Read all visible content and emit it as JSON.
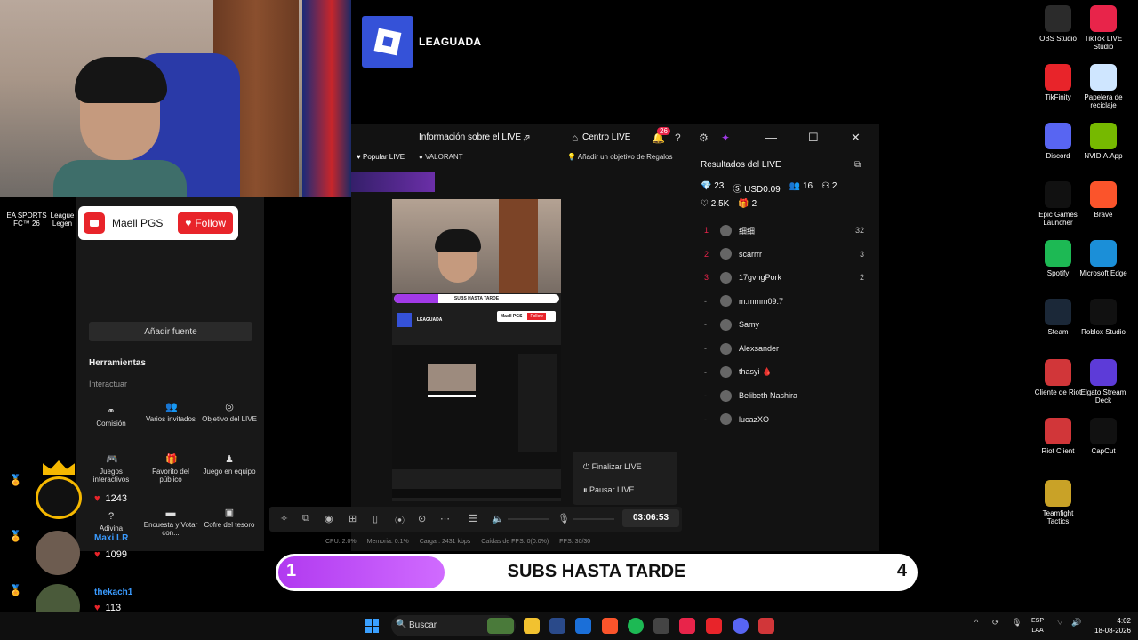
{
  "branding": {
    "overlay_logo_text": "LEAGUADA"
  },
  "follow_card": {
    "name": "Maell PGS",
    "button": "Follow"
  },
  "left_panel": {
    "add_source": "Añadir fuente",
    "tools_title": "Herramientas",
    "tools_sub": "Interactuar",
    "tools": [
      {
        "icon": "link-icon",
        "label": "Comisión"
      },
      {
        "icon": "guests-icon",
        "label": "Varios invitados"
      },
      {
        "icon": "target-icon",
        "label": "Objetivo del LIVE"
      },
      {
        "icon": "gamepad-icon",
        "label": "Juegos interactivos"
      },
      {
        "icon": "gift-icon",
        "label": "Favorito del público"
      },
      {
        "icon": "team-icon",
        "label": "Juego en equipo"
      },
      {
        "icon": "question-icon",
        "label": "Adivina"
      },
      {
        "icon": "poll-icon",
        "label": "Encuesta y Votar con..."
      },
      {
        "icon": "chest-icon",
        "label": "Cofre del tesoro"
      }
    ]
  },
  "studio": {
    "title": "Información sobre el LIVE",
    "centro": "Centro LIVE",
    "notif_count": "26",
    "tab_popular": "Popular LIVE",
    "tab_valorant": "VALORANT",
    "gift_goal": "Añadir un objetivo de Regalos",
    "results_title": "Resultados del LIVE",
    "stats": {
      "diamonds": "23",
      "usd": "USD0.09",
      "viewers": "16",
      "new_followers": "2",
      "likes": "2.5K",
      "gifters": "2"
    },
    "ranking": [
      {
        "rank": "1",
        "name": "细细",
        "score": "32"
      },
      {
        "rank": "2",
        "name": "scarrrr",
        "score": "3"
      },
      {
        "rank": "3",
        "name": "17gvngPork",
        "score": "2"
      },
      {
        "rank": "-",
        "name": "m.mmm09.7",
        "score": ""
      },
      {
        "rank": "-",
        "name": "Samy",
        "score": ""
      },
      {
        "rank": "-",
        "name": "Alexsander",
        "score": ""
      },
      {
        "rank": "-",
        "name": "thasyi 🩸.",
        "score": ""
      },
      {
        "rank": "-",
        "name": "Belibeth Nashira",
        "score": ""
      },
      {
        "rank": "-",
        "name": "lucazXO",
        "score": ""
      }
    ],
    "menu": {
      "end": "Finalizar LIVE",
      "pause": "Pausar LIVE"
    },
    "timer": "03:06:53",
    "status": {
      "cpu": "CPU: 2.0%",
      "mem": "Memoria: 0.1%",
      "load": "Cargar: 2431 kbps",
      "drops": "Caídas de FPS: 0(0.0%)",
      "fps": "FPS: 30/30"
    }
  },
  "preview": {
    "bar_text": "SUBS HASTA TARDE",
    "logo": "LEAGUADA",
    "follow_name": "Maell PGS",
    "follow_btn": "Follow"
  },
  "leaderboard": [
    {
      "name": "Maxi LR",
      "score": "1243"
    },
    {
      "name": "",
      "score": "1099"
    },
    {
      "name": "thekach1",
      "score": "113"
    }
  ],
  "subs_bar": {
    "current": "1",
    "label": "SUBS HASTA TARDE",
    "goal": "4",
    "progress": 0.25
  },
  "desktop_icons": [
    {
      "label": "OBS Studio",
      "color": "#2b2b2b"
    },
    {
      "label": "TikTok LIVE Studio",
      "color": "#e8244a"
    },
    {
      "label": "TikFinity",
      "color": "#e8242a"
    },
    {
      "label": "Papelera de reciclaje",
      "color": "#cfe6ff"
    },
    {
      "label": "Discord",
      "color": "#5865f2"
    },
    {
      "label": "NVIDIA.App",
      "color": "#76b900"
    },
    {
      "label": "Epic Games Launcher",
      "color": "#111111"
    },
    {
      "label": "Brave",
      "color": "#fb542b"
    },
    {
      "label": "Spotify",
      "color": "#1db954"
    },
    {
      "label": "Microsoft Edge",
      "color": "#1b8fd8"
    },
    {
      "label": "Steam",
      "color": "#1b2838"
    },
    {
      "label": "Roblox Studio",
      "color": "#111111"
    },
    {
      "label": "Cliente de Riot",
      "color": "#d13639"
    },
    {
      "label": "Elgato Stream Deck",
      "color": "#5d3bd8"
    },
    {
      "label": "Riot Client",
      "color": "#d13639"
    },
    {
      "label": "CapCut",
      "color": "#111111"
    },
    {
      "label": "Teamfight Tactics",
      "color": "#c9a227"
    }
  ],
  "left_desktop": {
    "ea": "EA SPORTS FC™ 26",
    "league": "League Legen"
  },
  "taskbar": {
    "search": "Buscar",
    "lang1": "ESP",
    "lang2": "LAA",
    "time": "4:02",
    "date": "18-08-2026"
  }
}
